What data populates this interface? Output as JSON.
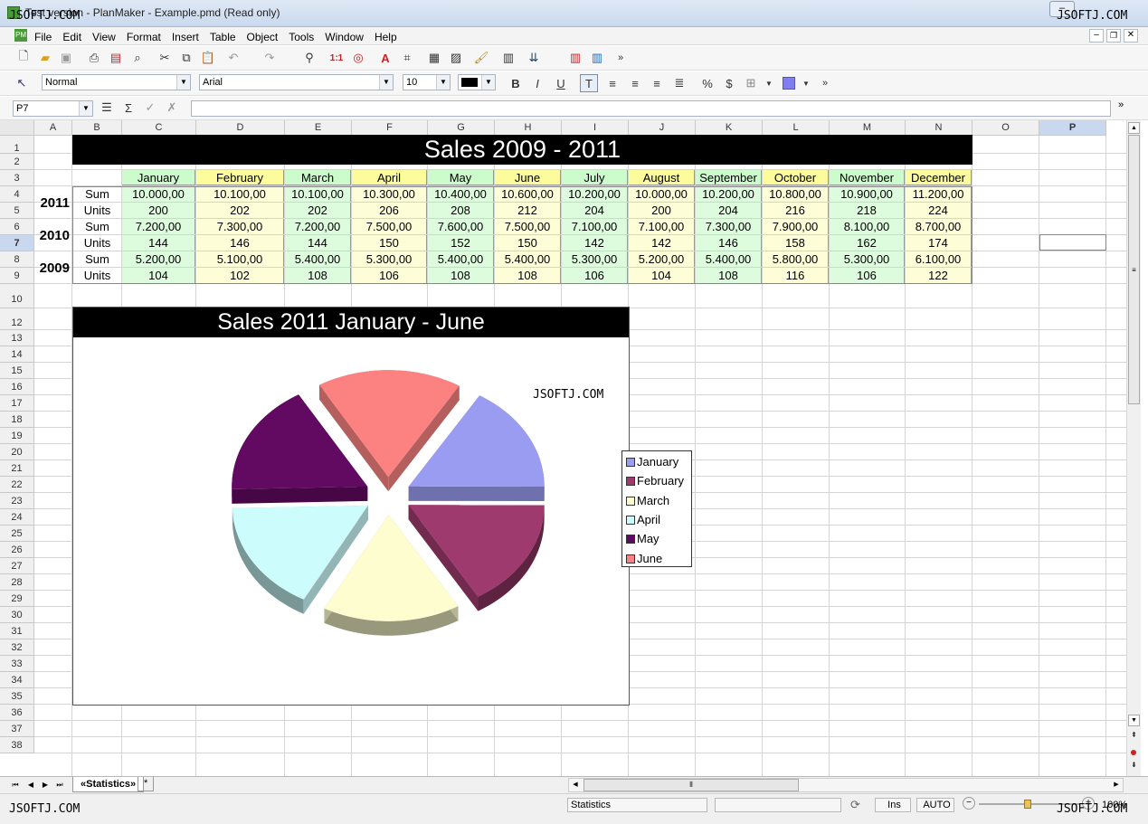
{
  "window": {
    "title": "Example.pmd (Read only)",
    "app_name": "PlanMaker",
    "title_prefix": "Test version",
    "title_sep": " - ",
    "watermark": "JSOFTJ.COM"
  },
  "menu": [
    "File",
    "Edit",
    "View",
    "Format",
    "Insert",
    "Table",
    "Object",
    "Tools",
    "Window",
    "Help"
  ],
  "format_bar": {
    "style": "Normal",
    "font": "Arial",
    "size": "10"
  },
  "formula_bar": {
    "cell_ref": "P7",
    "content": ""
  },
  "columns": [
    {
      "label": "A"
    },
    {
      "label": "B"
    },
    {
      "label": "C"
    },
    {
      "label": "D"
    },
    {
      "label": "E"
    },
    {
      "label": "F"
    },
    {
      "label": "G"
    },
    {
      "label": "H"
    },
    {
      "label": "I"
    },
    {
      "label": "J"
    },
    {
      "label": "K"
    },
    {
      "label": "L"
    },
    {
      "label": "M"
    },
    {
      "label": "N"
    },
    {
      "label": "O"
    },
    {
      "label": "P"
    }
  ],
  "rows": [
    "1",
    "2",
    "3",
    "4",
    "5",
    "6",
    "7",
    "8",
    "9",
    "10",
    "12",
    "13",
    "14",
    "15",
    "16",
    "17",
    "18",
    "19",
    "20",
    "21",
    "22",
    "23",
    "24",
    "25",
    "26",
    "27",
    "28",
    "29",
    "30",
    "31",
    "32",
    "33",
    "34",
    "35",
    "36",
    "37",
    "38"
  ],
  "sheet": {
    "title": "Sales 2009 - 2011",
    "months": [
      "January",
      "February",
      "March",
      "April",
      "May",
      "June",
      "July",
      "August",
      "September",
      "October",
      "November",
      "December"
    ],
    "records": [
      {
        "year": "2011",
        "label": "Sum",
        "values": [
          "10.000,00",
          "10.100,00",
          "10.100,00",
          "10.300,00",
          "10.400,00",
          "10.600,00",
          "10.200,00",
          "10.000,00",
          "10.200,00",
          "10.800,00",
          "10.900,00",
          "11.200,00"
        ]
      },
      {
        "year": "",
        "label": "Units",
        "values": [
          "200",
          "202",
          "202",
          "206",
          "208",
          "212",
          "204",
          "200",
          "204",
          "216",
          "218",
          "224"
        ]
      },
      {
        "year": "2010",
        "label": "Sum",
        "values": [
          "7.200,00",
          "7.300,00",
          "7.200,00",
          "7.500,00",
          "7.600,00",
          "7.500,00",
          "7.100,00",
          "7.100,00",
          "7.300,00",
          "7.900,00",
          "8.100,00",
          "8.700,00"
        ]
      },
      {
        "year": "",
        "label": "Units",
        "values": [
          "144",
          "146",
          "144",
          "150",
          "152",
          "150",
          "142",
          "142",
          "146",
          "158",
          "162",
          "174"
        ]
      },
      {
        "year": "2009",
        "label": "Sum",
        "values": [
          "5.200,00",
          "5.100,00",
          "5.400,00",
          "5.300,00",
          "5.400,00",
          "5.400,00",
          "5.300,00",
          "5.200,00",
          "5.400,00",
          "5.800,00",
          "5.300,00",
          "6.100,00"
        ]
      },
      {
        "year": "",
        "label": "Units",
        "values": [
          "104",
          "102",
          "108",
          "106",
          "108",
          "108",
          "106",
          "104",
          "108",
          "116",
          "106",
          "122"
        ]
      }
    ],
    "year_labels": [
      "2011",
      "2010",
      "2009"
    ]
  },
  "chart_data": {
    "type": "pie",
    "title": "Sales 2011 January - June",
    "categories": [
      "January",
      "February",
      "March",
      "April",
      "May",
      "June"
    ],
    "values": [
      10000,
      10100,
      10100,
      10300,
      10400,
      10600
    ],
    "colors": [
      "#9a9cf2",
      "#9e3a6e",
      "#fdfdd0",
      "#ccfcfc",
      "#620a62",
      "#fc8282"
    ],
    "legend": "right",
    "watermark": "JSOFTJ.COM"
  },
  "tabs": {
    "active": "«Statistics»",
    "new": "*"
  },
  "status": {
    "sheet": "Statistics",
    "mode": "Ins",
    "calc": "AUTO",
    "zoom": "100%",
    "watermark": "JSOFTJ.COM"
  }
}
